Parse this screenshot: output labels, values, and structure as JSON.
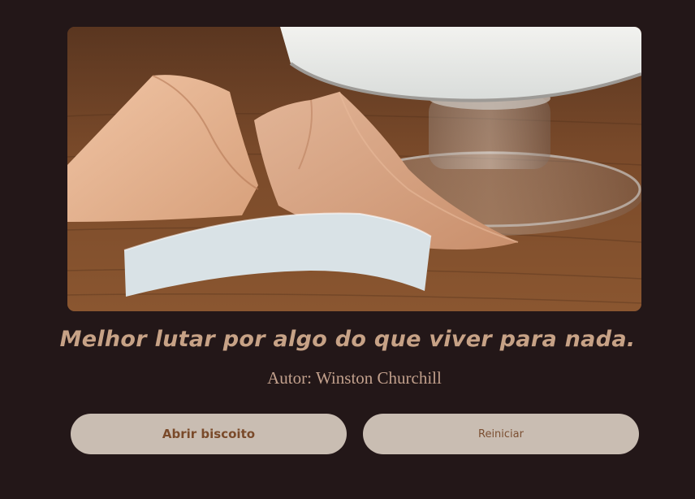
{
  "image": {
    "alt": "fortune-cookie-photo"
  },
  "quote": {
    "text": "Melhor lutar por algo do que viver para nada."
  },
  "author": {
    "label": "Autor:",
    "name": "Winston Churchill"
  },
  "buttons": {
    "open_label": "Abrir biscoito",
    "reset_label": "Reiniciar"
  },
  "colors": {
    "background": "#231718",
    "text_accent": "#c7a286",
    "button_bg": "#c9bdb2",
    "button_text": "#7a4a2a"
  }
}
